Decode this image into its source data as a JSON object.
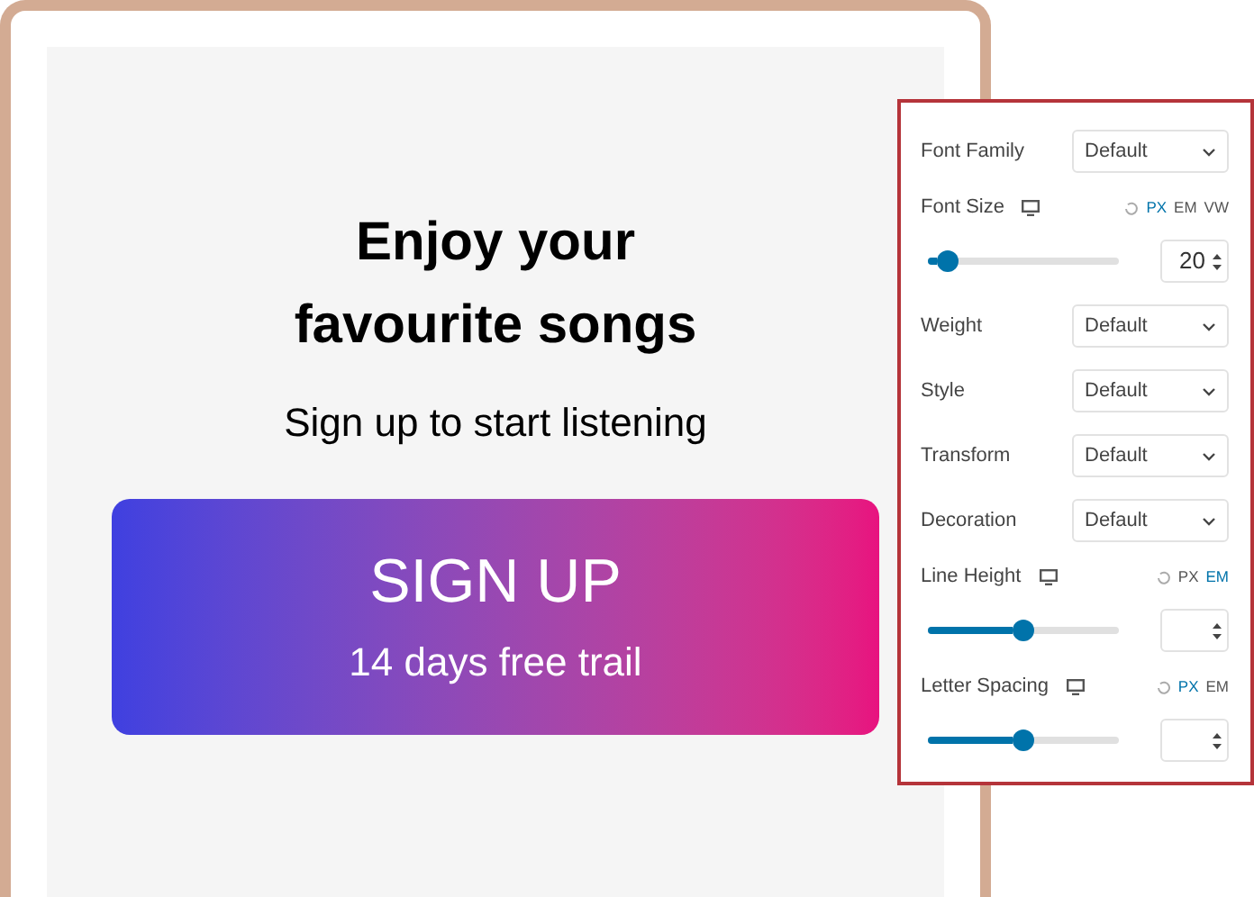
{
  "preview": {
    "heading": "Enjoy your favourite songs",
    "subheading": "Sign up to start listening",
    "button": {
      "label": "SIGN UP",
      "sublabel": "14 days free trail"
    }
  },
  "typography_panel": {
    "controls": [
      {
        "kind": "select",
        "label": "Font Family",
        "value": "Default"
      },
      {
        "kind": "slider",
        "label": "Font Size",
        "units": [
          {
            "label": "PX",
            "selected": true
          },
          {
            "label": "EM",
            "selected": false
          },
          {
            "label": "VW",
            "selected": false
          }
        ],
        "level": 0.1,
        "value": "20"
      },
      {
        "kind": "select",
        "label": "Weight",
        "value": "Default"
      },
      {
        "kind": "select",
        "label": "Style",
        "value": "Default"
      },
      {
        "kind": "select",
        "label": "Transform",
        "value": "Default"
      },
      {
        "kind": "select",
        "label": "Decoration",
        "value": "Default"
      },
      {
        "kind": "slider",
        "label": "Line Height",
        "units": [
          {
            "label": "PX",
            "selected": false
          },
          {
            "label": "EM",
            "selected": true
          }
        ],
        "level": 0.5
      },
      {
        "kind": "slider",
        "label": "Letter Spacing",
        "units": [
          {
            "label": "PX",
            "selected": true
          },
          {
            "label": "EM",
            "selected": false
          }
        ],
        "level": 0.5
      }
    ]
  }
}
